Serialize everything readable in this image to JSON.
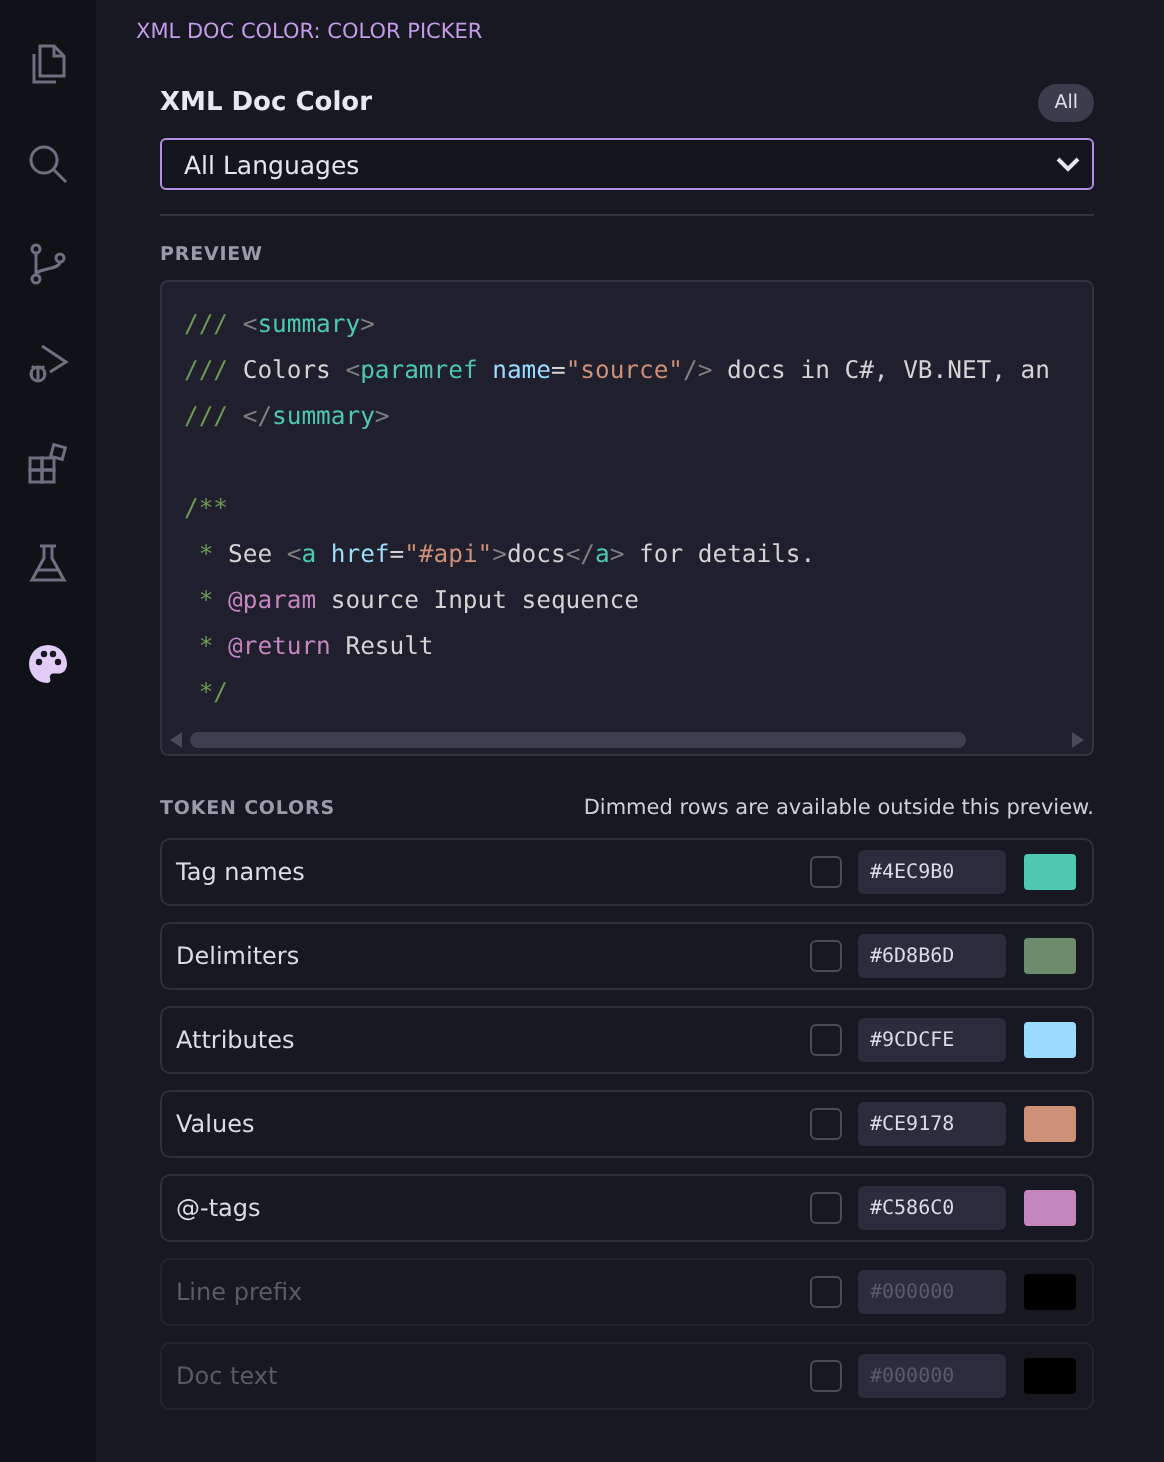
{
  "activity_bar": {
    "items": [
      {
        "kind": "files",
        "selected": false
      },
      {
        "kind": "search",
        "selected": false
      },
      {
        "kind": "branch",
        "selected": false
      },
      {
        "kind": "debug",
        "selected": false
      },
      {
        "kind": "extensions",
        "selected": false
      },
      {
        "kind": "flask",
        "selected": false
      },
      {
        "kind": "palette",
        "selected": true
      }
    ]
  },
  "panel": {
    "title": "XML DOC COLOR: COLOR PICKER",
    "heading": "XML Doc Color",
    "badge": "All",
    "language_select": {
      "value": "All Languages"
    }
  },
  "preview": {
    "label": "PREVIEW",
    "lines": [
      {
        "kind": "code",
        "segments": [
          {
            "kind": "prefix",
            "text": "/// "
          },
          {
            "kind": "punct",
            "text": "<"
          },
          {
            "kind": "tag",
            "text": "summary"
          },
          {
            "kind": "punct",
            "text": ">"
          }
        ]
      },
      {
        "kind": "code",
        "segments": [
          {
            "kind": "prefix",
            "text": "/// "
          },
          {
            "kind": "text",
            "text": "Colors "
          },
          {
            "kind": "punct",
            "text": "<"
          },
          {
            "kind": "tag",
            "text": "paramref"
          },
          {
            "kind": "attr",
            "text": " name"
          },
          {
            "kind": "text",
            "text": "="
          },
          {
            "kind": "value",
            "text": "\"source\""
          },
          {
            "kind": "punct",
            "text": "/>"
          },
          {
            "kind": "text",
            "text": " docs in C#, VB.NET, an"
          }
        ]
      },
      {
        "kind": "code",
        "segments": [
          {
            "kind": "prefix",
            "text": "/// "
          },
          {
            "kind": "punct",
            "text": "</"
          },
          {
            "kind": "tag",
            "text": "summary"
          },
          {
            "kind": "punct",
            "text": ">"
          }
        ]
      },
      {
        "kind": "blank"
      },
      {
        "kind": "code",
        "segments": [
          {
            "kind": "prefix",
            "text": "/**"
          }
        ]
      },
      {
        "kind": "code",
        "segments": [
          {
            "kind": "prefix",
            "text": " * "
          },
          {
            "kind": "text",
            "text": "See "
          },
          {
            "kind": "punct",
            "text": "<"
          },
          {
            "kind": "tag",
            "text": "a"
          },
          {
            "kind": "attr",
            "text": " href"
          },
          {
            "kind": "text",
            "text": "="
          },
          {
            "kind": "value",
            "text": "\"#api\""
          },
          {
            "kind": "punct",
            "text": ">"
          },
          {
            "kind": "text",
            "text": "docs"
          },
          {
            "kind": "punct",
            "text": "</"
          },
          {
            "kind": "tag",
            "text": "a"
          },
          {
            "kind": "punct",
            "text": ">"
          },
          {
            "kind": "text",
            "text": " for details."
          }
        ]
      },
      {
        "kind": "code",
        "segments": [
          {
            "kind": "prefix",
            "text": " * "
          },
          {
            "kind": "at",
            "text": "@param"
          },
          {
            "kind": "text",
            "text": " source Input sequence"
          }
        ]
      },
      {
        "kind": "code",
        "segments": [
          {
            "kind": "prefix",
            "text": " * "
          },
          {
            "kind": "at",
            "text": "@return"
          },
          {
            "kind": "text",
            "text": " Result"
          }
        ]
      },
      {
        "kind": "code",
        "segments": [
          {
            "kind": "prefix",
            "text": " */"
          }
        ]
      }
    ]
  },
  "token_colors": {
    "label": "TOKEN COLORS",
    "note": "Dimmed rows are available outside this preview.",
    "rows": [
      {
        "label": "Tag names",
        "checked": false,
        "hex": "#4EC9B0",
        "color": "#4ec9b0",
        "disabled": false
      },
      {
        "label": "Delimiters",
        "checked": false,
        "hex": "#6D8B6D",
        "color": "#6d8b6d",
        "disabled": false
      },
      {
        "label": "Attributes",
        "checked": false,
        "hex": "#9CDCFE",
        "color": "#9cdcfe",
        "disabled": false
      },
      {
        "label": "Values",
        "checked": false,
        "hex": "#CE9178",
        "color": "#ce9178",
        "disabled": false
      },
      {
        "label": "@-tags",
        "checked": false,
        "hex": "#C586C0",
        "color": "#c586c0",
        "disabled": false
      },
      {
        "label": "Line prefix",
        "checked": false,
        "hex": "#000000",
        "color": "#000000",
        "disabled": true
      },
      {
        "label": "Doc text",
        "checked": false,
        "hex": "#000000",
        "color": "#000000",
        "disabled": true
      }
    ]
  }
}
